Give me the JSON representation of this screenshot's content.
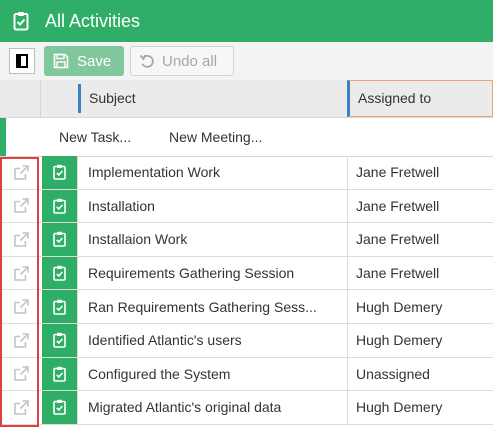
{
  "app": {
    "title": "All Activities",
    "icon": "clipboard-check-icon"
  },
  "toolbar": {
    "toggle_icon": "sidebar-toggle-icon",
    "save_label": "Save",
    "save_icon": "floppy-disk-icon",
    "undo_label": "Undo all",
    "undo_icon": "undo-icon"
  },
  "grid": {
    "columns": [
      "Subject",
      "Assigned to"
    ],
    "new_actions": [
      "New Task...",
      "New Meeting..."
    ],
    "rows": [
      {
        "subject": "Implementation Work",
        "assigned": "Jane Fretwell"
      },
      {
        "subject": "Installation",
        "assigned": "Jane Fretwell"
      },
      {
        "subject": "Installaion Work",
        "assigned": "Jane Fretwell"
      },
      {
        "subject": "Requirements Gathering Session",
        "assigned": "Jane Fretwell"
      },
      {
        "subject": "Ran Requirements Gathering Sess...",
        "assigned": "Hugh Demery"
      },
      {
        "subject": "Identified Atlantic's users",
        "assigned": "Hugh Demery"
      },
      {
        "subject": "Configured the System",
        "assigned": "Unassigned"
      },
      {
        "subject": "Migrated Atlantic's original data",
        "assigned": "Hugh Demery"
      }
    ],
    "row_icons": {
      "open": "external-link-icon",
      "type": "task-clipboard-icon"
    }
  },
  "colors": {
    "brand_green": "#2eae66",
    "save_green": "#80c79b",
    "highlight_red": "#e04040",
    "column_accent": "#3a82c4"
  }
}
